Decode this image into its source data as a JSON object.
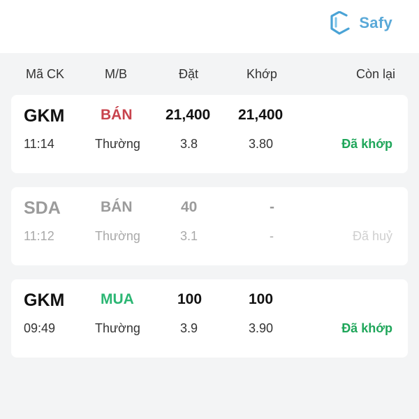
{
  "header": {
    "brand_name": "Safy"
  },
  "columns": [
    "Mã CK",
    "M/B",
    "Đặt",
    "Khớp",
    "Còn lại"
  ],
  "orders": [
    {
      "symbol": "GKM",
      "side": "BÁN",
      "qty": "21,400",
      "matched_qty": "21,400",
      "time": "11:14",
      "order_type": "Thường",
      "price": "3.8",
      "matched_price": "3.80",
      "status": "Đã khớp"
    },
    {
      "symbol": "SDA",
      "side": "BÁN",
      "qty": "40",
      "matched_qty": "-",
      "time": "11:12",
      "order_type": "Thường",
      "price": "3.1",
      "matched_price": "-",
      "status": "Đã huỷ"
    },
    {
      "symbol": "GKM",
      "side": "MUA",
      "qty": "100",
      "matched_qty": "100",
      "time": "09:49",
      "order_type": "Thường",
      "price": "3.9",
      "matched_price": "3.90",
      "status": "Đã khớp"
    }
  ],
  "colors": {
    "sell": "#c8434d",
    "buy": "#2bb673",
    "matched_status": "#1fa65a",
    "brand": "#5aa9d8"
  }
}
